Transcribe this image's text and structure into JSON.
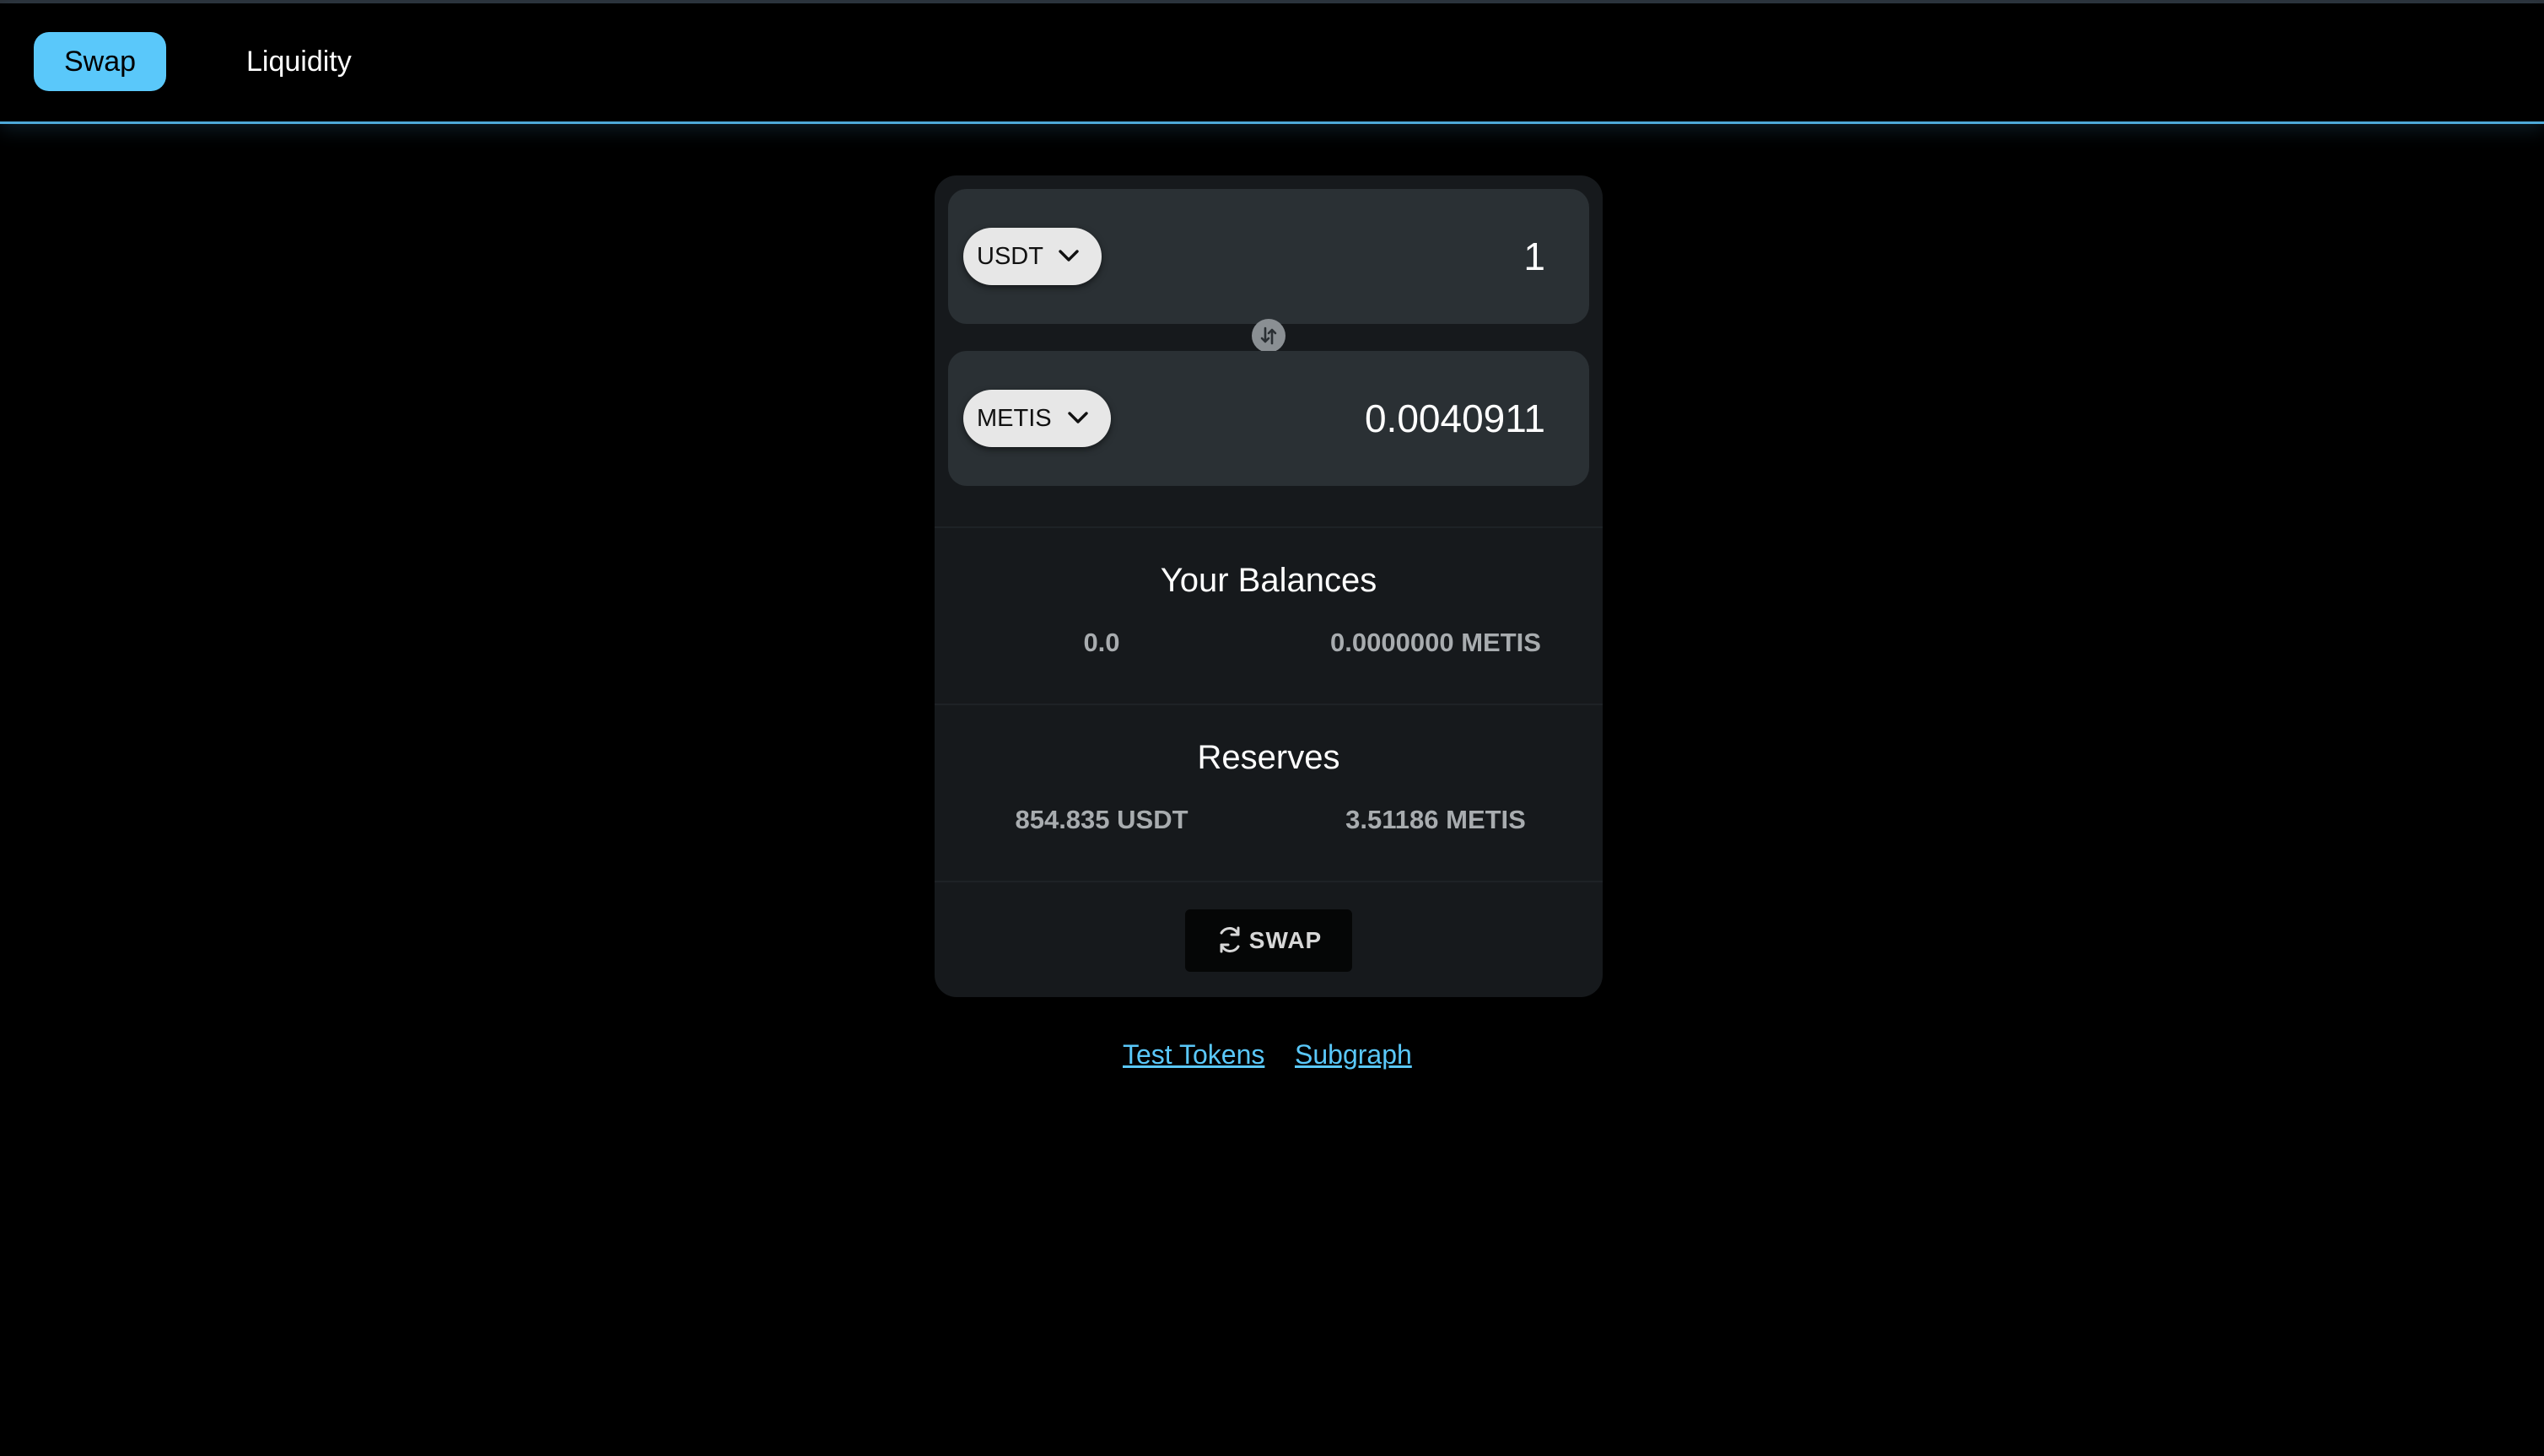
{
  "nav": {
    "tabs": [
      {
        "label": "Swap",
        "active": true
      },
      {
        "label": "Liquidity",
        "active": false
      }
    ]
  },
  "swap": {
    "from": {
      "token": "USDT",
      "amount": "1"
    },
    "to": {
      "token": "METIS",
      "amount": "0.0040911"
    },
    "button_label": "SWAP"
  },
  "balances": {
    "title": "Your Balances",
    "left": "0.0",
    "right": "0.0000000 METIS"
  },
  "reserves": {
    "title": "Reserves",
    "left": "854.835 USDT",
    "right": "3.51186 METIS"
  },
  "footer": {
    "links": [
      "Test Tokens",
      "Subgraph"
    ]
  },
  "colors": {
    "accent": "#5ac8fa",
    "background": "#000000",
    "card": "#16191c",
    "input_box": "#2a3034"
  }
}
